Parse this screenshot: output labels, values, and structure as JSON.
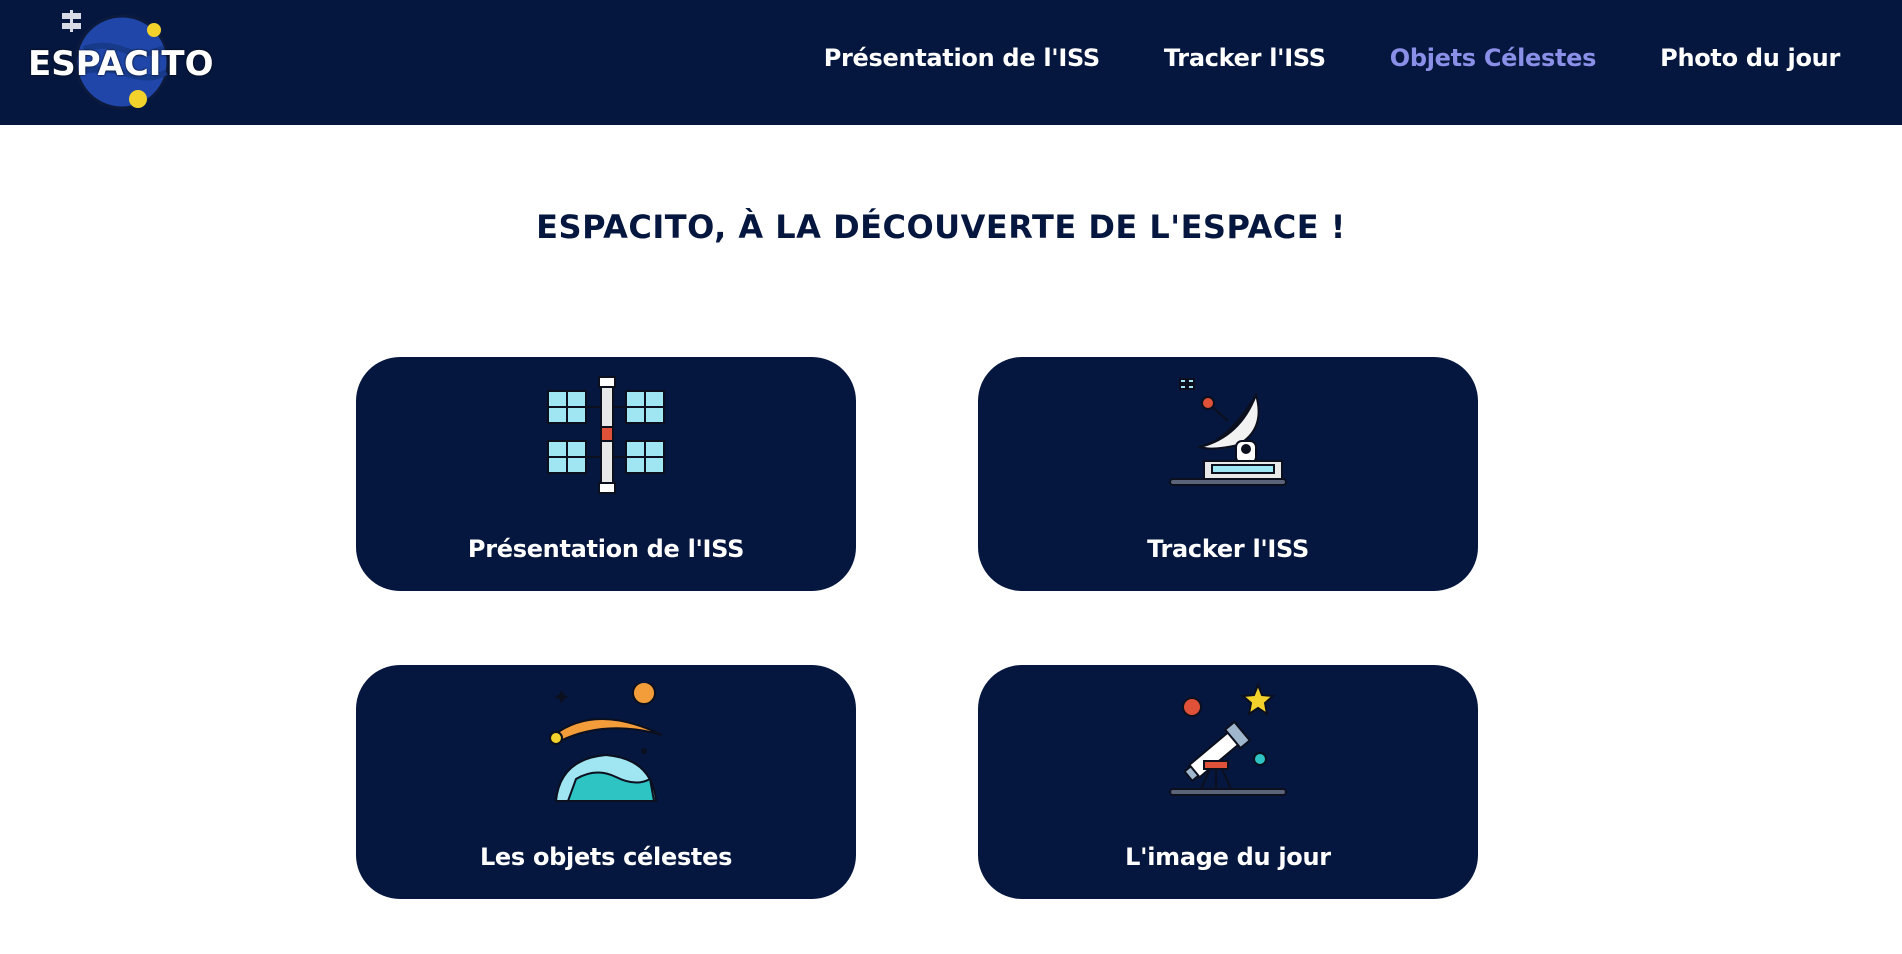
{
  "brand": {
    "name": "ESPACITO",
    "colors": {
      "navy": "#06173f",
      "active": "#8a8fe8",
      "white": "#ffffff"
    }
  },
  "nav": {
    "items": [
      {
        "label": "Présentation de l'ISS",
        "active": false
      },
      {
        "label": "Tracker l'ISS",
        "active": false
      },
      {
        "label": "Objets Célestes",
        "active": true
      },
      {
        "label": "Photo du jour",
        "active": false
      }
    ]
  },
  "main": {
    "title": "ESPACITO, À LA DÉCOUVERTE DE L'ESPACE !",
    "cards": [
      {
        "label": "Présentation de l'ISS",
        "icon": "space-station-icon"
      },
      {
        "label": "Tracker l'ISS",
        "icon": "satellite-dish-icon"
      },
      {
        "label": "Les objets célestes",
        "icon": "planet-comet-icon"
      },
      {
        "label": "L'image du jour",
        "icon": "telescope-icon"
      }
    ]
  }
}
